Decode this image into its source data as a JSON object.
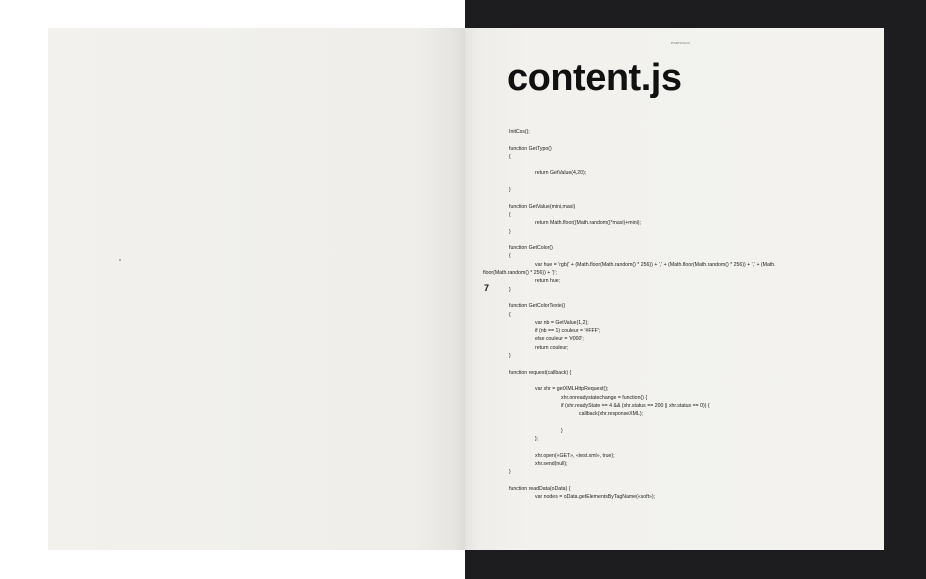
{
  "header": {
    "small_label": "PORTFOLIO",
    "title": "content.js",
    "page_number": "7"
  },
  "code_lines": [
    "InitCss();",
    "",
    "function GetTypo()",
    "{",
    "",
    "return GetValue(4,20);",
    "",
    "}",
    "",
    "function GetValue(mini,maxi)",
    "{",
    "return Math.floor((Math.random()*maxi)+mini);",
    "}",
    "",
    "function GetColor()",
    "{",
    "var hue = 'rgb(' + (Math.floor(Math.random() * 256)) + ',' + (Math.floor(Math.random() * 256)) + ',' + (Math.",
    "floor(Math.random() * 256)) + ')';",
    "return hue;",
    "}",
    "",
    "function GetColorTexte()",
    "{",
    "var nb = GetValue(1,2);",
    "if (nb == 1) couleur = '#FFF';",
    "else couleur = '#000';",
    "return couleur;",
    "}",
    "",
    "function request(callback) {",
    "",
    "var xhr = getXMLHttpRequest();",
    "xhr.onreadystatechange = function() {",
    "if (xhr.readyState == 4 && (xhr.status == 200 || xhr.status == 0)) {",
    "callback(xhr.responseXML);",
    "",
    "}",
    "};",
    "",
    "xhr.open(«GET», «test.xml», true);",
    "xhr.send(null);",
    "}",
    "",
    "function readData(oData) {",
    "var nodes = oData.getElementsByTagName(«soft»);"
  ]
}
